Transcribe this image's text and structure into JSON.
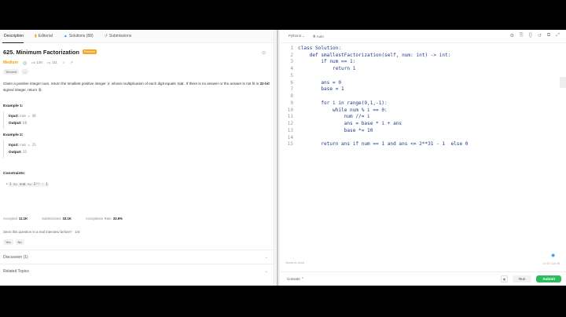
{
  "tabs": [
    {
      "label": "Description",
      "icon": "doc-icon",
      "glyph": ""
    },
    {
      "label": "Editorial",
      "icon": "book-icon",
      "glyph": "📖"
    },
    {
      "label": "Solutions (88)",
      "icon": "flask-icon",
      "glyph": "⚗"
    },
    {
      "label": "Submissions",
      "icon": "history-icon",
      "glyph": "⟲"
    }
  ],
  "problem": {
    "title": "625. Minimum Factorization",
    "premium_badge": "Premium",
    "difficulty": "Medium",
    "likes": "125",
    "dislikes": "111",
    "tags": [
      "Tencent",
      "..."
    ],
    "desc_part1": "Given a positive integer num, return the smallest positive integer ",
    "desc_code1": "x",
    "desc_part2": " whose multiplication of each digit equals ",
    "desc_code2": "num",
    "desc_part3": ". If there is no answer or the answer is not fit in ",
    "desc_bold": "32-bit",
    "desc_part4": " signed integer, return ",
    "desc_code3": "0",
    "desc_part5": "."
  },
  "examples": [
    {
      "heading": "Example 1:",
      "input_label": "Input:",
      "input_value": "num = 48",
      "output_label": "Output:",
      "output_value": "68"
    },
    {
      "heading": "Example 2:",
      "input_label": "Input:",
      "input_value": "num = 15",
      "output_label": "Output:",
      "output_value": "35"
    }
  ],
  "constraints": {
    "heading": "Constraints:",
    "item": "1 <= num <= 2³¹ - 1"
  },
  "stats": {
    "accepted_label": "Accepted",
    "accepted_value": "11.1K",
    "submissions_label": "Submissions",
    "submissions_value": "33.1K",
    "rate_label": "Acceptance Rate",
    "rate_value": "33.6%"
  },
  "interview": {
    "question": "Seen this question in a real interview before?",
    "count": "1/4",
    "yes": "Yes",
    "no": "No"
  },
  "accordions": [
    "Discussion (1)",
    "Related Topics"
  ],
  "editor": {
    "language": "Python3",
    "auto": "Auto",
    "code_lines": [
      "class Solution:",
      "    def smallestFactorization(self, num: int) -> int:",
      "        if num == 1:",
      "            return 1",
      "",
      "        ans = 0",
      "        base = 1",
      "",
      "        for i in range(9,1,-1):",
      "            while num % i == 0:",
      "                num //= i",
      "                ans = base * i + ans",
      "                base *= 10",
      "",
      "        return ans if num == 1 and ans <= 2**31 - 1  else 0"
    ],
    "saved": "Saved to cloud",
    "cursor": "Ln 15, Col 46"
  },
  "bottom": {
    "console": "Console",
    "run": "Run",
    "submit": "Submit"
  },
  "colors": {
    "accent_green": "#2cbb5d",
    "medium": "#f5a000",
    "premium": "#f5a623"
  }
}
